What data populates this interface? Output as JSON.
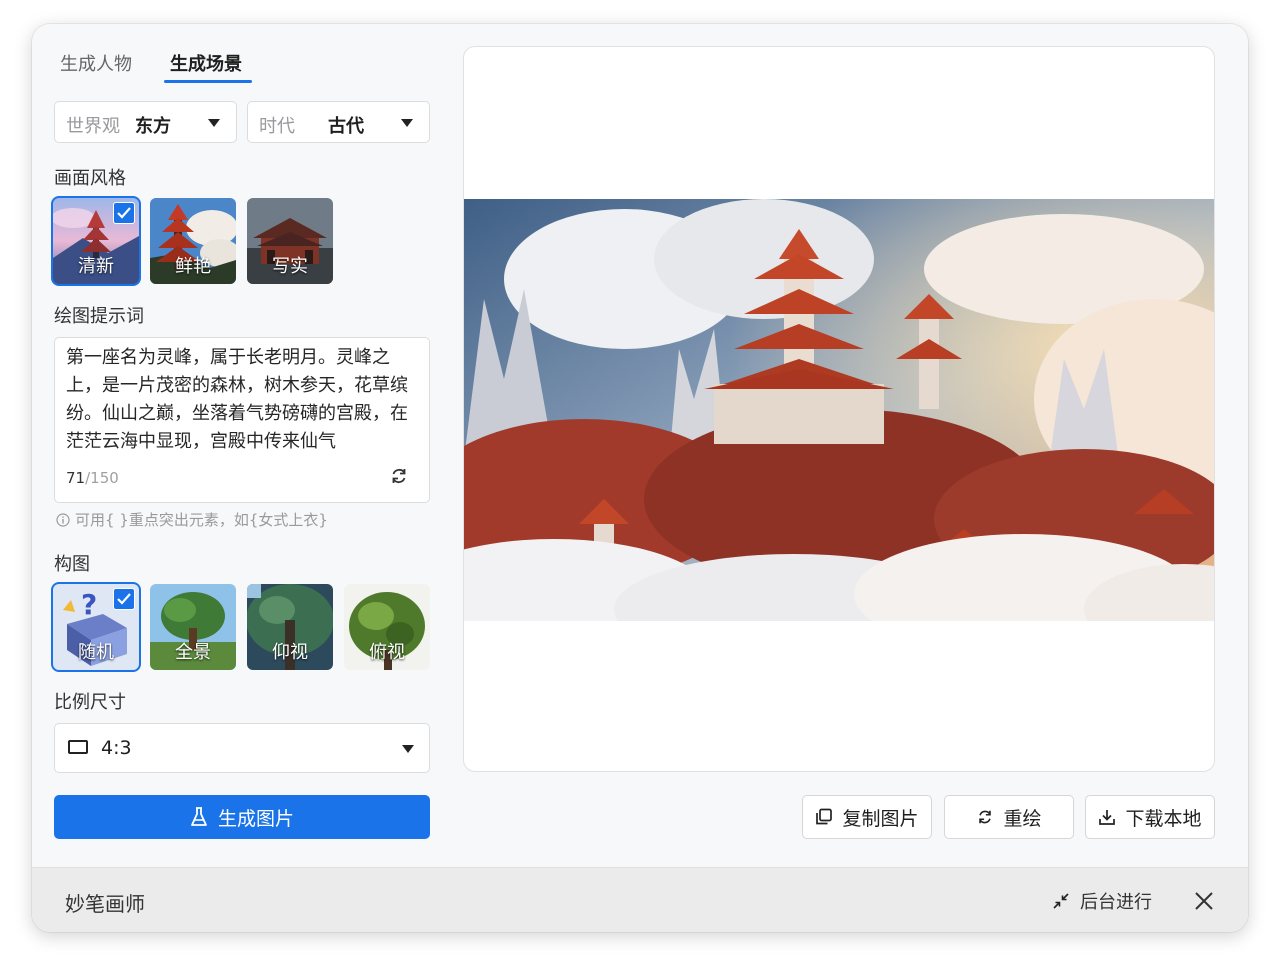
{
  "tabs": [
    {
      "label": "生成人物",
      "active": false
    },
    {
      "label": "生成场景",
      "active": true
    }
  ],
  "filters": {
    "worldview": {
      "label": "世界观",
      "value": "东方"
    },
    "era": {
      "label": "时代",
      "value": "古代"
    }
  },
  "style_section": {
    "label": "画面风格",
    "options": [
      {
        "label": "清新",
        "selected": true
      },
      {
        "label": "鲜艳",
        "selected": false
      },
      {
        "label": "写实",
        "selected": false
      }
    ]
  },
  "prompt_section": {
    "label": "绘图提示词",
    "text": "第一座名为灵峰，属于长老明月。灵峰之上，是一片茂密的森林，树木参天，花草缤纷。仙山之巅，坐落着气势磅礴的宫殿，在茫茫云海中显现，宫殿中传来仙气",
    "count": "71",
    "max": "/150",
    "hint": "可用{ }重点突出元素，如{女式上衣}"
  },
  "composition_section": {
    "label": "构图",
    "options": [
      {
        "label": "随机",
        "selected": true
      },
      {
        "label": "全景",
        "selected": false
      },
      {
        "label": "仰视",
        "selected": false
      },
      {
        "label": "俯视",
        "selected": false
      }
    ]
  },
  "ratio_section": {
    "label": "比例尺寸",
    "value": "4:3"
  },
  "generate_button": "生成图片",
  "actions": {
    "copy": "复制图片",
    "redraw": "重绘",
    "download": "下载本地"
  },
  "footer": {
    "title": "妙笔画师",
    "background_run": "后台进行"
  },
  "colors": {
    "accent": "#1a73e8"
  }
}
